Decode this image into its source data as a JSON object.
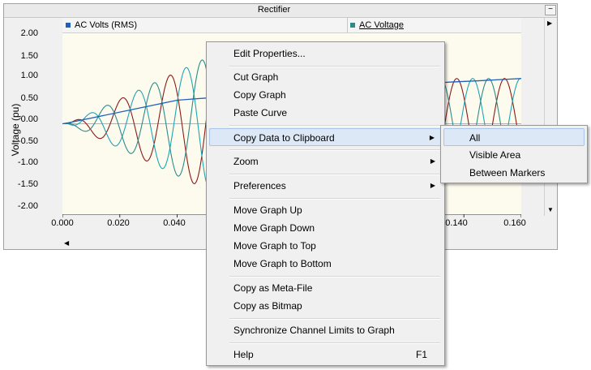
{
  "panel": {
    "title": "Rectifier",
    "minimize_label": "−"
  },
  "legend": [
    {
      "label": "AC Volts (RMS)",
      "color": "#1f5fbf"
    },
    {
      "label": "AC Voltage",
      "color": "#2e8a8a"
    }
  ],
  "chart_data": {
    "type": "line",
    "ylabel": "Voltage (pu)",
    "xlabel": "",
    "ylim": [
      -2.0,
      2.0
    ],
    "xlim": [
      0.0,
      0.16
    ],
    "yticks": [
      "2.00",
      "1.50",
      "1.00",
      "0.50",
      "0.00",
      "-0.50",
      "-1.00",
      "-1.50",
      "-2.00"
    ],
    "xticks": [
      "0.000",
      "0.020",
      "0.040",
      "0.140",
      "0.160"
    ],
    "colors": {
      "rms": "#1f5fbf",
      "phase_a": "#8b1a1a",
      "phase_b": "#1aa6b7",
      "phase_c": "#2e8a8a"
    },
    "series": [
      {
        "name": "AC Volts (RMS)",
        "x": [
          0.0,
          0.002,
          0.04,
          0.046,
          0.135,
          0.145,
          0.16
        ],
        "y": [
          0.0,
          0.02,
          0.52,
          0.55,
          0.92,
          0.95,
          1.0
        ]
      }
    ]
  },
  "menu": {
    "items": [
      {
        "label": "Edit Properties...",
        "shortcut": "",
        "submenu": false
      },
      {
        "label": "Cut Graph",
        "shortcut": "",
        "submenu": false
      },
      {
        "label": "Copy Graph",
        "shortcut": "",
        "submenu": false
      },
      {
        "label": "Paste Curve",
        "shortcut": "",
        "submenu": false
      },
      {
        "label": "Copy Data to Clipboard",
        "shortcut": "",
        "submenu": true
      },
      {
        "label": "Zoom",
        "shortcut": "",
        "submenu": true
      },
      {
        "label": "Preferences",
        "shortcut": "",
        "submenu": true
      },
      {
        "label": "Move Graph Up",
        "shortcut": "",
        "submenu": false
      },
      {
        "label": "Move Graph Down",
        "shortcut": "",
        "submenu": false
      },
      {
        "label": "Move Graph to Top",
        "shortcut": "",
        "submenu": false
      },
      {
        "label": "Move Graph to Bottom",
        "shortcut": "",
        "submenu": false
      },
      {
        "label": "Copy as Meta-File",
        "shortcut": "",
        "submenu": false
      },
      {
        "label": "Copy as Bitmap",
        "shortcut": "",
        "submenu": false
      },
      {
        "label": "Synchronize Channel Limits to Graph",
        "shortcut": "",
        "submenu": false
      },
      {
        "label": "Help",
        "shortcut": "F1",
        "submenu": false
      }
    ],
    "submenu_arrow": "▶"
  },
  "submenu": {
    "items": [
      {
        "label": "All"
      },
      {
        "label": "Visible Area"
      },
      {
        "label": "Between Markers"
      }
    ]
  }
}
